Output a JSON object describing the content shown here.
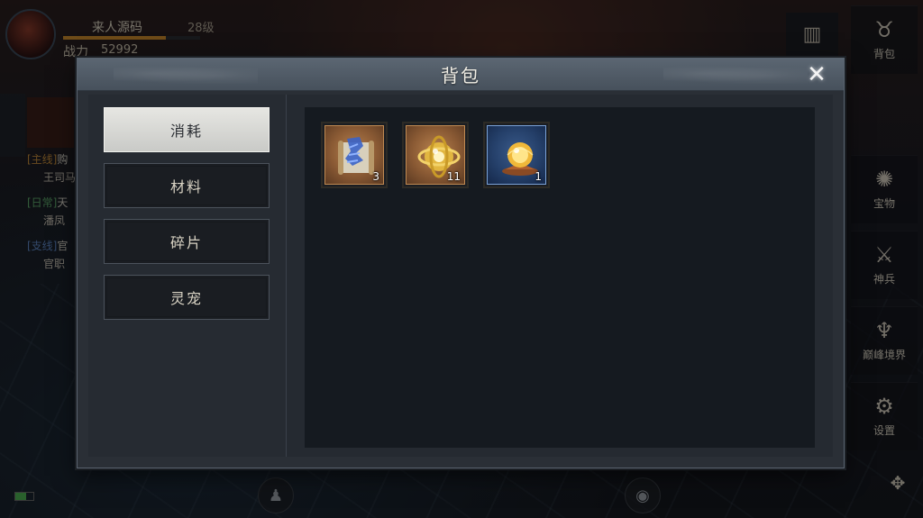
{
  "player": {
    "name": "来人源码",
    "level": "28级",
    "power_label": "战力",
    "power_value": "52992",
    "exp_progress": 0.75
  },
  "quests": [
    {
      "tag": "[主线]",
      "text": "购",
      "sub": "王司马"
    },
    {
      "tag": "[日常]",
      "text": "天",
      "sub": "潘凤"
    },
    {
      "tag": "[支线]",
      "text": "官",
      "sub": "官职"
    }
  ],
  "right_menu": [
    {
      "label": "背包",
      "icon": "bag-icon"
    },
    {
      "label": "宝物",
      "icon": "treasure-icon"
    },
    {
      "label": "神兵",
      "icon": "divine-weapon-icon"
    },
    {
      "label": "巅峰境界",
      "icon": "peak-realm-icon"
    },
    {
      "label": "设置",
      "icon": "gear-icon"
    }
  ],
  "dialog": {
    "title": "背包",
    "close_icon": "close-icon",
    "categories": [
      {
        "label": "消耗",
        "active": true
      },
      {
        "label": "材料",
        "active": false
      },
      {
        "label": "碎片",
        "active": false
      },
      {
        "label": "灵宠",
        "active": false
      }
    ],
    "items": [
      {
        "icon": "blue-scroll-icon",
        "rarity": "orange",
        "count": "3"
      },
      {
        "icon": "golden-armillary-icon",
        "rarity": "orange",
        "count": "11"
      },
      {
        "icon": "golden-orb-on-stand-icon",
        "rarity": "blue",
        "count": "1"
      }
    ]
  },
  "colors": {
    "dialog_bg": "#2a2f36",
    "active_tab": "#e6e6e2",
    "orange_rarity": "#c08a52",
    "blue_rarity": "#7aa2d8"
  }
}
